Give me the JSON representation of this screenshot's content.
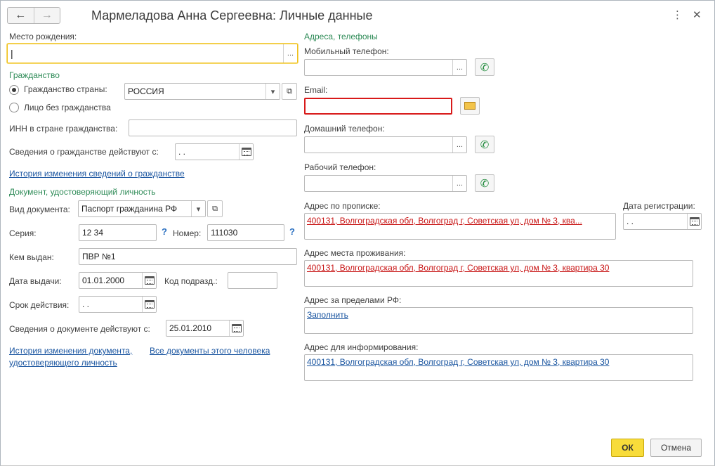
{
  "window": {
    "title": "Мармеладова Анна Сергеевна: Личные данные",
    "back_icon": "arrow-left-icon",
    "forward_icon": "arrow-right-icon",
    "more_icon": "more-vertical-icon",
    "close_icon": "close-icon"
  },
  "left": {
    "birthplace": {
      "label": "Место рождения:",
      "value": "|",
      "btn": "..."
    },
    "citizenship": {
      "section": "Гражданство",
      "radio_country": "Гражданство страны:",
      "radio_stateless": "Лицо без гражданства",
      "country_value": "РОССИЯ",
      "inn_label": "ИНН в стране гражданства:",
      "inn_value": "",
      "valid_label": "Сведения о гражданстве действуют с:",
      "valid_value": " .  .",
      "history_link": "История изменения сведений о гражданстве"
    },
    "document": {
      "section": "Документ, удостоверяющий личность",
      "type_label": "Вид документа:",
      "type_value": "Паспорт гражданина РФ",
      "series_label": "Серия:",
      "series_value": "12 34",
      "number_label": "Номер:",
      "number_value": "111030",
      "help_mark": "?",
      "issued_by_label": "Кем выдан:",
      "issued_by_value": "ПВР №1",
      "issue_date_label": "Дата выдачи:",
      "issue_date_value": "01.01.2000",
      "dept_code_label": "Код подразд.:",
      "dept_code_value": "",
      "expiry_label": "Срок действия:",
      "expiry_value": " .  .",
      "valid_label": "Сведения о документе действуют с:",
      "valid_value": "25.01.2010",
      "history_link_line1": "История изменения документа,",
      "history_link_line2": "удостоверяющего личность",
      "all_docs_link": "Все документы этого человека"
    }
  },
  "right": {
    "section": "Адреса, телефоны",
    "mobile_label": "Мобильный телефон:",
    "mobile_value": "",
    "email_label": "Email:",
    "email_value": "",
    "home_label": "Домашний телефон:",
    "home_value": "",
    "work_label": "Рабочий телефон:",
    "work_value": "",
    "reg_address_label": "Адрес по прописке:",
    "reg_address_value": "400131, Волгоградская обл, Волгоград г, Советская ул, дом № 3, ква...",
    "reg_date_label": "Дата регистрации:",
    "reg_date_value": " .  .",
    "live_address_label": "Адрес места проживания:",
    "live_address_value": "400131, Волгоградская обл, Волгоград г, Советская ул, дом № 3, квартира 30",
    "abroad_label": "Адрес за пределами РФ:",
    "abroad_value": "Заполнить",
    "info_address_label": "Адрес для информирования:",
    "info_address_value": "400131, Волгоградская обл, Волгоград г, Советская ул, дом № 3, квартира 30"
  },
  "footer": {
    "ok": "ОК",
    "cancel": "Отмена"
  },
  "colors": {
    "accent_green": "#2e8b57",
    "link_blue": "#1a55a0",
    "error_red": "#d81a1a",
    "ok_yellow": "#f8dc3a"
  }
}
